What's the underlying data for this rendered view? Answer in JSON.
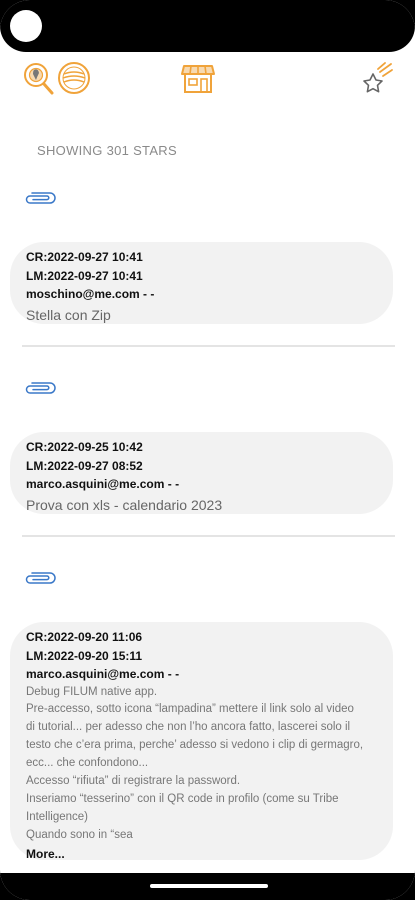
{
  "header": {
    "showing_label": "SHOWING 301 STARS",
    "accent_color": "#f0a33a",
    "icons": [
      "search-location-icon",
      "stamp-icon",
      "store-icon",
      "shooting-star-icon"
    ]
  },
  "stars": [
    {
      "created": "CR:2022-09-27 10:41",
      "modified": "LM:2022-09-27 10:41",
      "author": "moschino@me.com - -",
      "title": "Stella con Zip"
    },
    {
      "created": "CR:2022-09-25 10:42",
      "modified": "LM:2022-09-27 08:52",
      "author": "marco.asquini@me.com - -",
      "title": "Prova con xls - calendario 2023"
    },
    {
      "created": "CR:2022-09-20 11:06",
      "modified": "LM:2022-09-20 15:11",
      "author": "marco.asquini@me.com - -",
      "body": [
        "Debug FILUM native app.",
        "Pre-accesso, sotto icona “lampadina” mettere il link solo al video",
        "di tutorial... per adesso che non l’ho ancora fatto, lascerei solo il",
        "testo che c’era prima, perche’ adesso si vedono i clip di germagro,",
        "ecc... che confondono...",
        "Accesso “rifiuta” di registrare la password.",
        "Inseriamo “tesserino” con il QR code in profilo (come su Tribe",
        "Intelligence)",
        "Quando sono in “sea"
      ],
      "more": "More..."
    }
  ]
}
